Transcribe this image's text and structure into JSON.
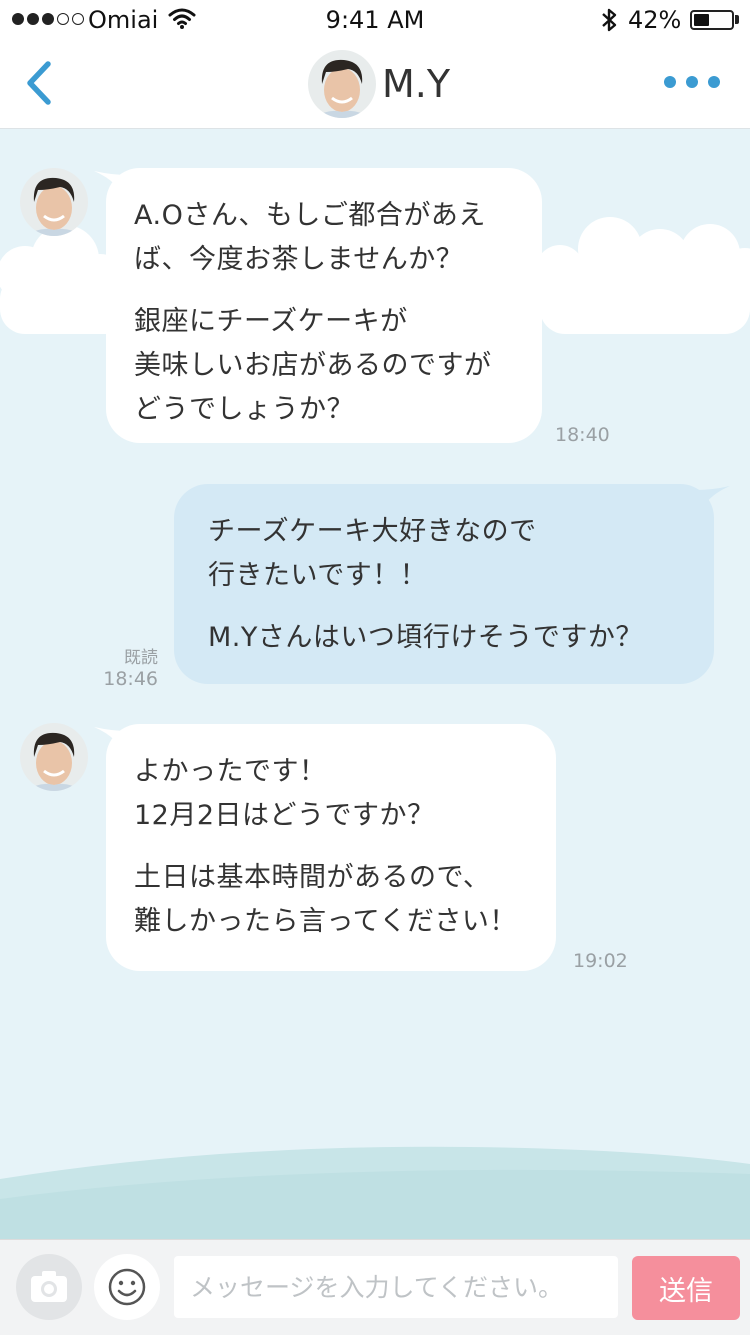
{
  "status_bar": {
    "carrier": "Omiai",
    "time": "9:41 AM",
    "battery_percent": "42%",
    "battery_level": 0.42,
    "signal_bars_filled": 3,
    "signal_bars_total": 5
  },
  "header": {
    "title": "M.Y",
    "back_icon": "chevron-left-icon",
    "more_icon": "more-dots-icon"
  },
  "messages": [
    {
      "direction": "incoming",
      "paragraphs": [
        "A.Oさん、もしご都合があえ\nば、今度お茶しませんか？",
        "銀座にチーズケーキが\n美味しいお店があるのですが\nどうでしょうか？"
      ],
      "time": "18:40"
    },
    {
      "direction": "outgoing",
      "paragraphs": [
        "チーズケーキ大好きなので\n行きたいです！！",
        "M.Yさんはいつ頃行けそうですか？"
      ],
      "read_label": "既読",
      "time": "18:46"
    },
    {
      "direction": "incoming",
      "paragraphs": [
        "よかったです！\n12月2日はどうですか？",
        "土日は基本時間があるので、\n難しかったら言ってください！"
      ],
      "time": "19:02"
    }
  ],
  "input_bar": {
    "placeholder": "メッセージを入力してください。",
    "send_label": "送信"
  },
  "colors": {
    "accent_blue": "#3b9bd2",
    "chat_background": "#e6f3f8",
    "outgoing_bubble": "#d4e9f5",
    "send_button": "#f58f9c"
  }
}
